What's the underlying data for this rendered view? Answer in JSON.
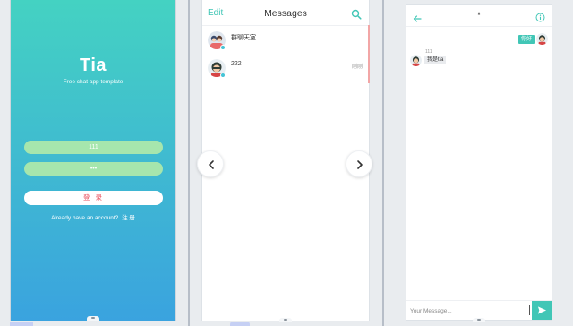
{
  "login": {
    "app_name": "Tia",
    "tagline": "Free chat app template",
    "username_value": "111",
    "password_value": "•••",
    "login_label": "登 录",
    "signup_prompt": "Already have an account?",
    "signup_link": "注 册"
  },
  "messages": {
    "edit_label": "Edit",
    "title": "Messages",
    "conversations": [
      {
        "name": "群聊天室",
        "time": ""
      },
      {
        "name": "222",
        "time": "刚刚"
      }
    ]
  },
  "chat": {
    "title": "*",
    "outgoing": [
      {
        "text": "你好"
      }
    ],
    "incoming": [
      {
        "sender": "111",
        "text": "我是tia"
      }
    ],
    "input_placeholder": "Your Message..."
  },
  "colors": {
    "accent": "#41c6b6",
    "gradient_top": "#44d2c2",
    "gradient_bottom": "#3aa3df",
    "field_green": "#a6e6ad",
    "login_text": "#e8525f"
  }
}
